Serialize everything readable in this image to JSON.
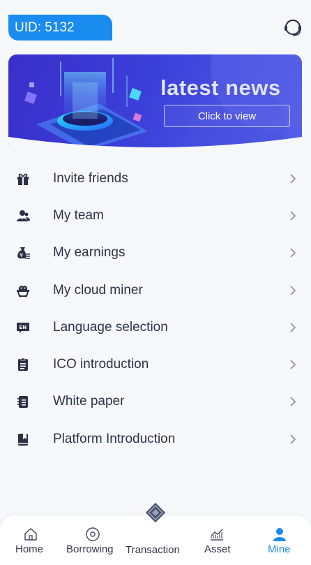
{
  "header": {
    "uid_text": "UID: 5132"
  },
  "banner": {
    "title": "latest news",
    "button_label": "Click to view"
  },
  "menu": {
    "items": [
      {
        "label": "Invite friends",
        "icon": "gift-icon"
      },
      {
        "label": "My team",
        "icon": "team-icon"
      },
      {
        "label": "My earnings",
        "icon": "earnings-bag-icon"
      },
      {
        "label": "My cloud miner",
        "icon": "cloud-miner-icon"
      },
      {
        "label": "Language selection",
        "icon": "language-en-icon"
      },
      {
        "label": "ICO introduction",
        "icon": "document-icon"
      },
      {
        "label": "White paper",
        "icon": "notebook-icon"
      },
      {
        "label": "Platform Introduction",
        "icon": "book-icon"
      }
    ]
  },
  "tabbar": {
    "tabs": [
      {
        "label": "Home",
        "icon": "home-icon"
      },
      {
        "label": "Borrowing",
        "icon": "borrowing-circle-icon"
      },
      {
        "label": "Transaction",
        "icon": "transaction-diamond-icon"
      },
      {
        "label": "Asset",
        "icon": "asset-chart-icon"
      },
      {
        "label": "Mine",
        "icon": "user-icon"
      }
    ],
    "active": "Mine"
  },
  "colors": {
    "accent": "#1a8cf0",
    "icon_dark": "#2b3245",
    "background": "#f7f8fc"
  }
}
